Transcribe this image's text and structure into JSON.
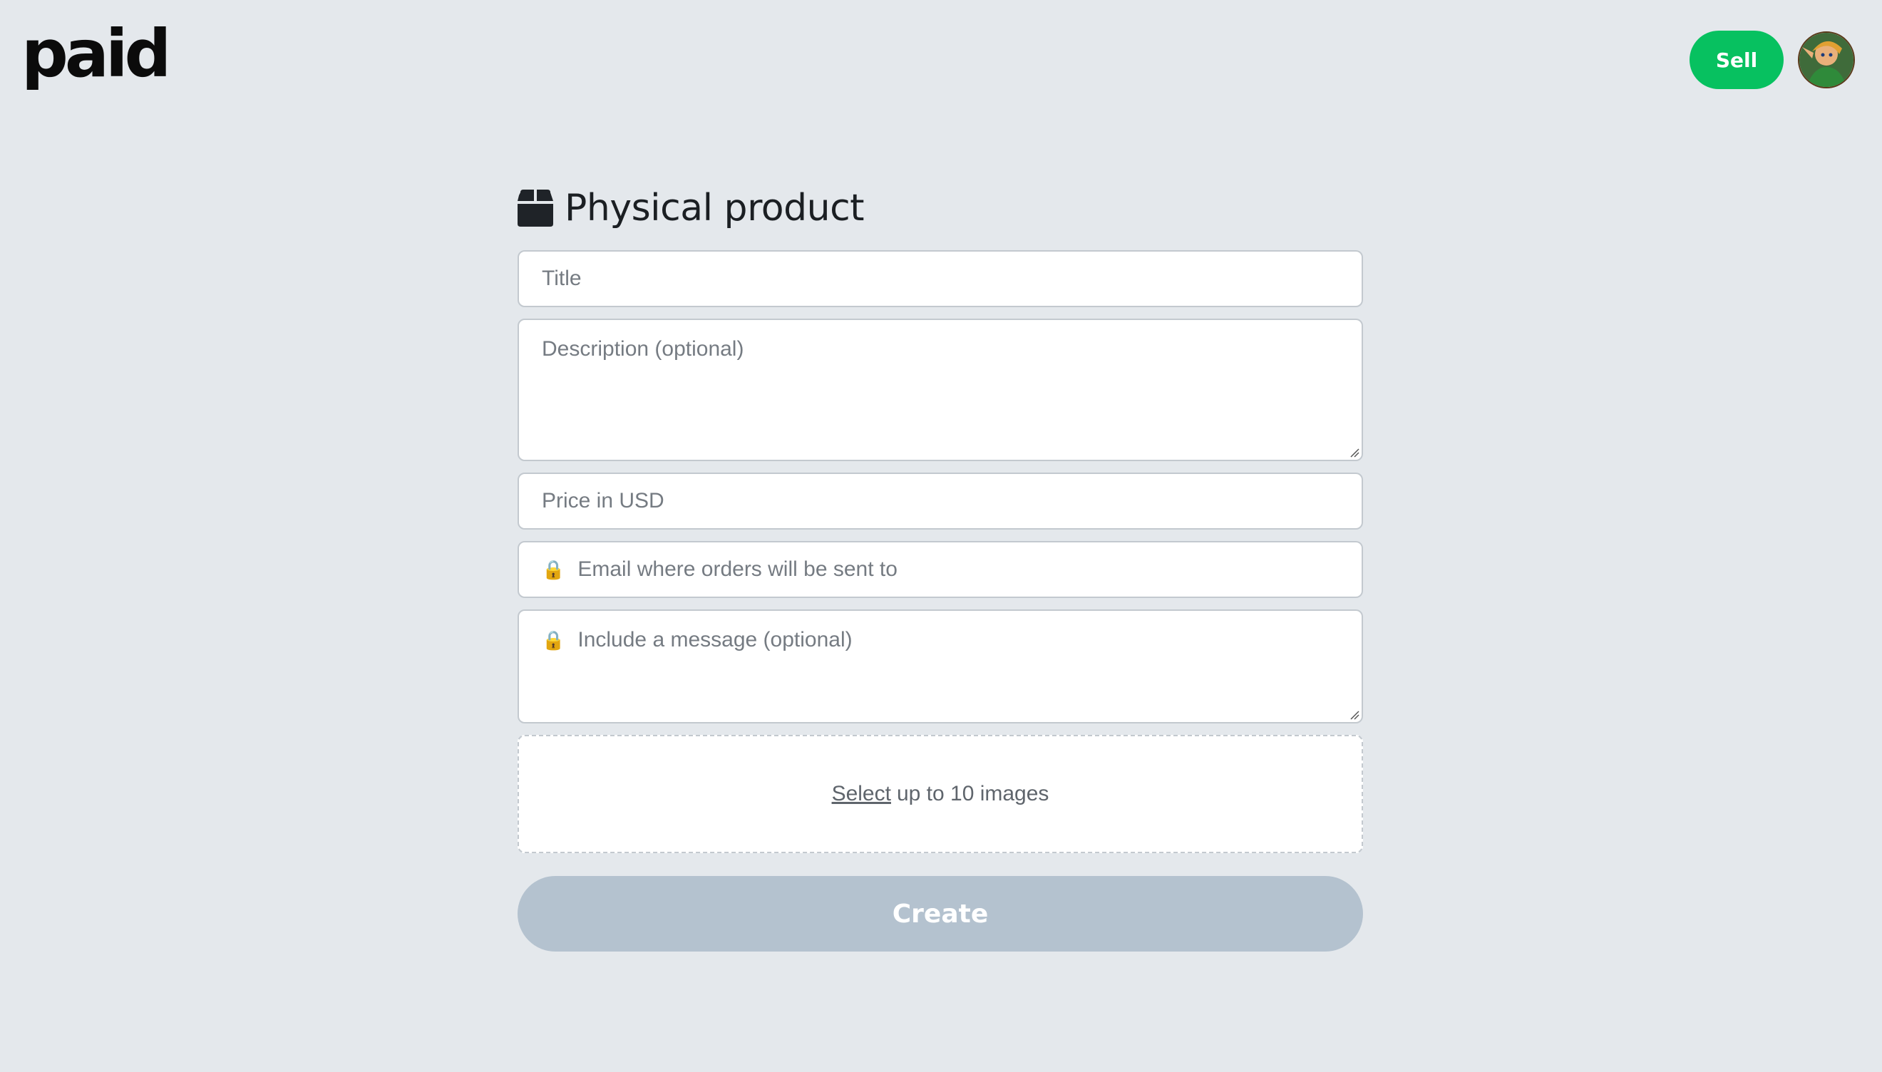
{
  "header": {
    "logo_text": "paid",
    "sell_label": "Sell",
    "avatar_icon": "user-avatar"
  },
  "form": {
    "heading": "Physical product",
    "heading_icon": "box-icon",
    "title_placeholder": "Title",
    "description_placeholder": "Description (optional)",
    "price_placeholder": "Price in USD",
    "email_placeholder": "Email where orders will be sent to",
    "message_placeholder": "Include a message (optional)",
    "lock_glyph": "🔒",
    "images": {
      "select_label": "Select",
      "rest_label": "up to 10 images"
    },
    "create_label": "Create"
  },
  "colors": {
    "background": "#e4e8ec",
    "sell_button": "#07c160",
    "create_button_disabled": "#b4c2cf"
  }
}
